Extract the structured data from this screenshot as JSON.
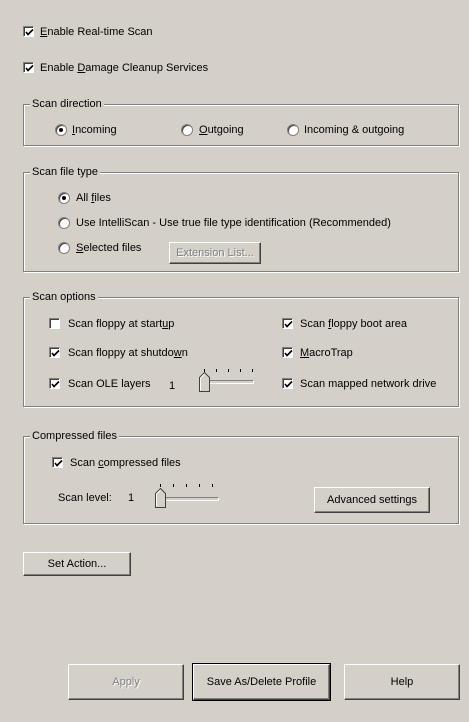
{
  "options": {
    "realtime_scan": {
      "label": "Enable Real-time Scan",
      "checked": true
    },
    "damage_cleanup": {
      "label": "Enable Damage Cleanup Services",
      "checked": true
    }
  },
  "scan_direction": {
    "title": "Scan direction",
    "options": [
      "Incoming",
      "Outgoing",
      "Incoming & outgoing"
    ],
    "selected": "Incoming"
  },
  "scan_file_type": {
    "title": "Scan file type",
    "all_files": "All files",
    "intelliscan": "Use IntelliScan - Use true file type identification (Recommended)",
    "selected_files": "Selected files",
    "selected": "All files",
    "extension_button": "Extension List..."
  },
  "scan_options": {
    "title": "Scan options",
    "floppy_startup": {
      "label": "Scan floppy at startup",
      "checked": false
    },
    "floppy_shutdown": {
      "label": "Scan floppy at shutdown",
      "checked": true
    },
    "ole_layers": {
      "label": "Scan OLE layers",
      "checked": true
    },
    "ole_level": "1",
    "floppy_boot": {
      "label": "Scan floppy boot area",
      "checked": true
    },
    "macrotrap": {
      "label": "MacroTrap",
      "checked": true
    },
    "mapped_drive": {
      "label": "Scan mapped network drive",
      "checked": true
    },
    "ole_slider_fraction": 0.0
  },
  "compressed_files": {
    "title": "Compressed files",
    "scan_compressed": {
      "label": "Scan compressed files",
      "checked": true
    },
    "scan_level_label": "Scan level:",
    "scan_level_value": "1",
    "slider_fraction": 0.0,
    "advanced_button": "Advanced settings"
  },
  "set_action_button": "Set Action...",
  "footer": {
    "apply": "Apply",
    "save_profile": "Save As/Delete Profile",
    "help": "Help"
  }
}
